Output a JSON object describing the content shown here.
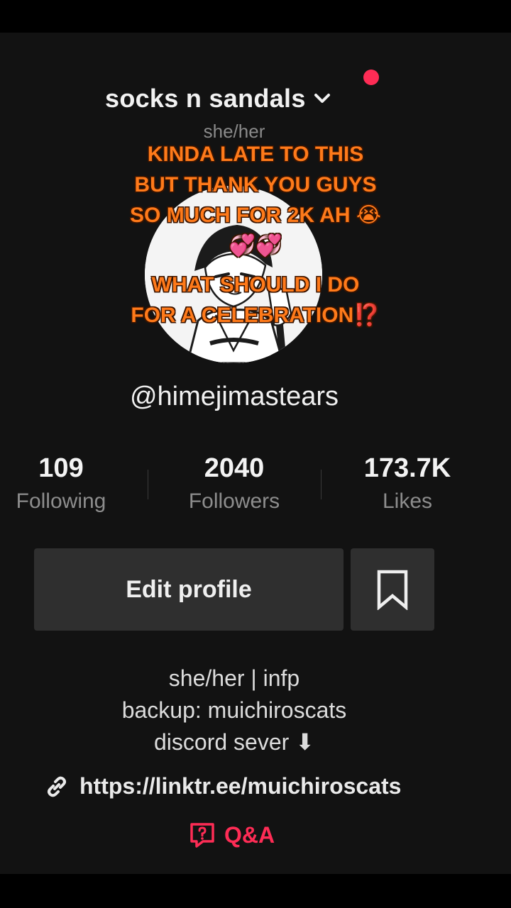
{
  "profile": {
    "display_name": "socks n sandals",
    "pronouns": "she/her",
    "handle": "@himejimastears"
  },
  "overlay_caption": {
    "line1": "KINDA LATE TO THIS",
    "line2": "BUT THANK YOU GUYS",
    "line3": "SO MUCH FOR 2K AH 😭",
    "line4": "💞💞",
    "line5": "WHAT SHOULD I DO",
    "line6": "FOR A CELEBRATION⁉️"
  },
  "stats": {
    "following": {
      "value": "109",
      "label": "Following"
    },
    "followers": {
      "value": "2040",
      "label": "Followers"
    },
    "likes": {
      "value": "173.7K",
      "label": "Likes"
    }
  },
  "actions": {
    "edit_profile_label": "Edit profile",
    "bookmark_icon": "bookmark-icon"
  },
  "bio": {
    "line1": "she/her | infp",
    "line2": "backup: muichiroscats",
    "line3": "discord sever ⬇"
  },
  "link": {
    "icon": "link-icon",
    "url": "https://linktr.ee/muichiroscats"
  },
  "qa": {
    "icon": "question-bubble-icon",
    "label": "Q&A"
  },
  "colors": {
    "background": "#121212",
    "notification_dot": "#fe2c55",
    "caption_orange": "#ff7a1a",
    "qa_accent": "#fe2c55"
  }
}
